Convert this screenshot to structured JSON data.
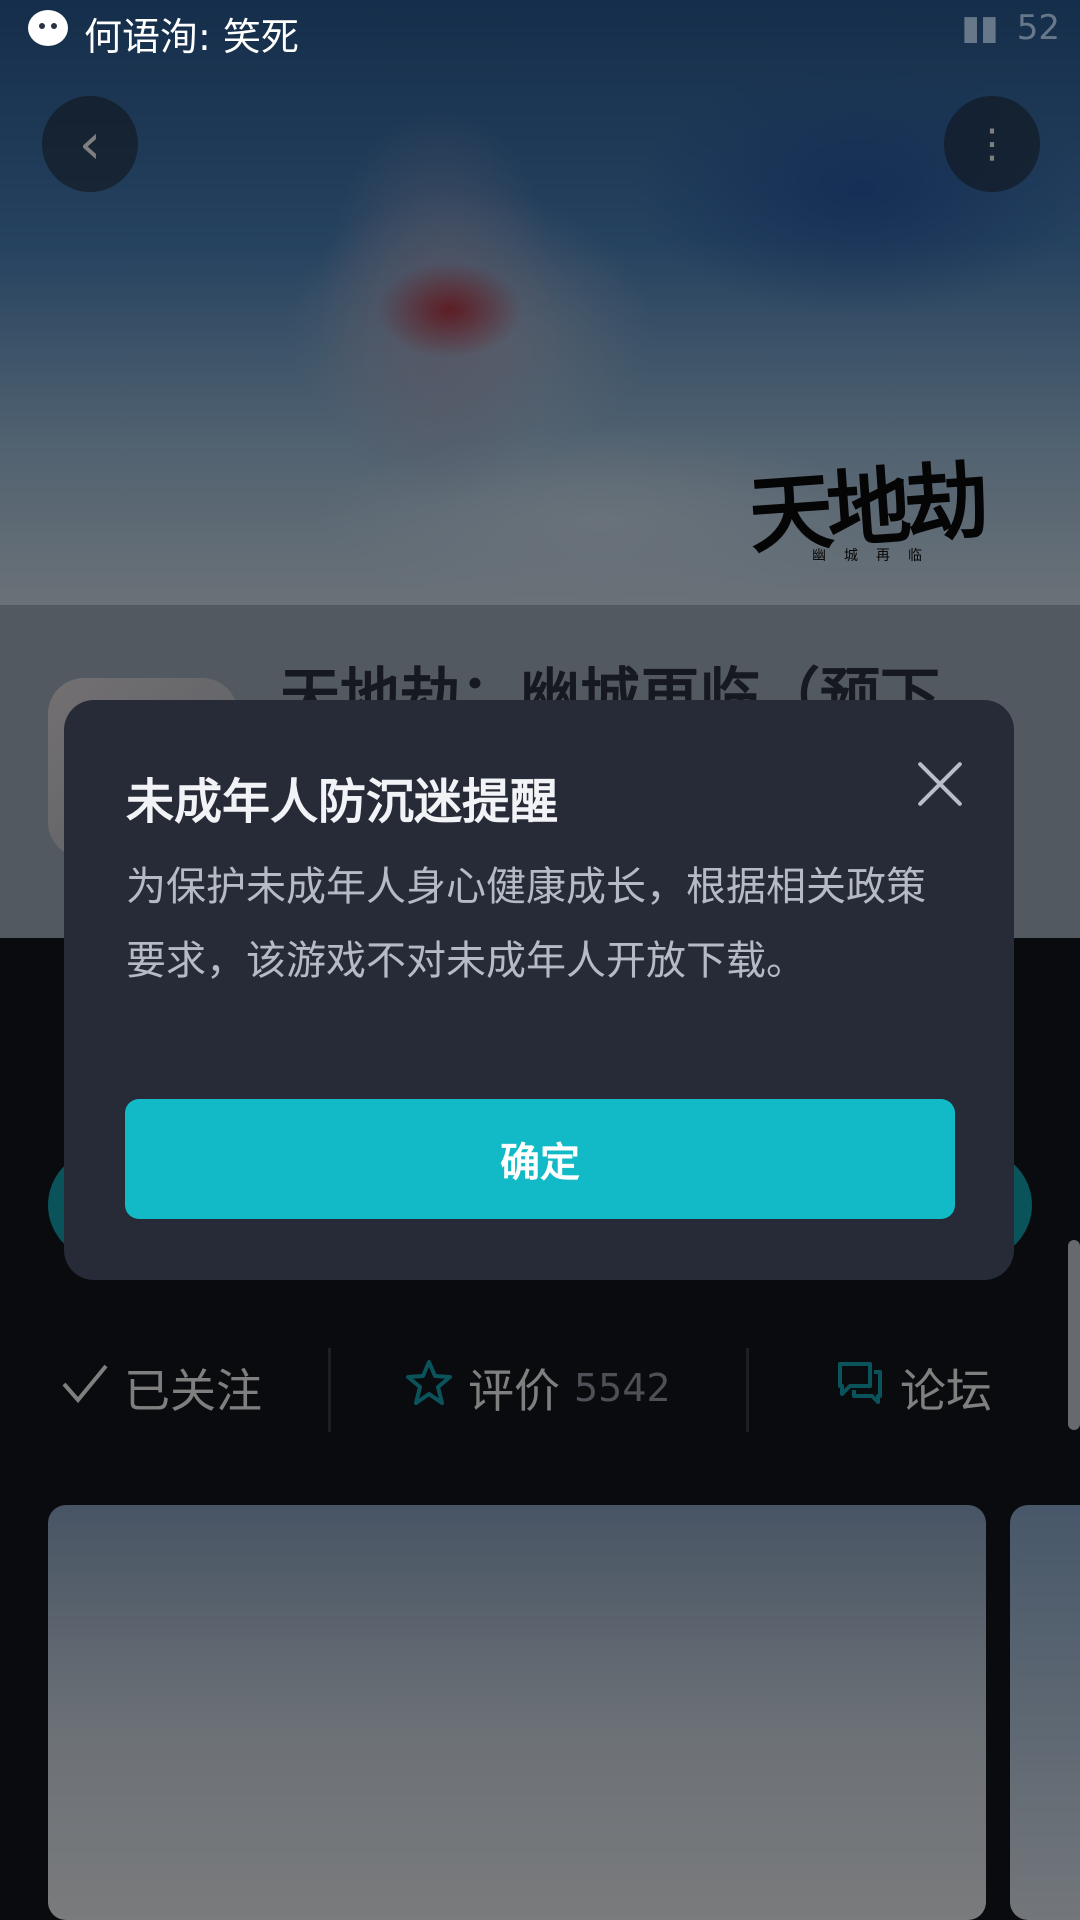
{
  "status_bar": {
    "notification_icon": "wechat-icon",
    "notification_text": "何语洵: 笑死",
    "battery_text": "52"
  },
  "hero": {
    "logo_text": "天地劫",
    "logo_subtitle": "幽城再临"
  },
  "game": {
    "title": "天地劫：幽城再临（预下"
  },
  "actions": {
    "follow_label": "已关注",
    "rate_label": "评价",
    "rate_count": "5542",
    "forum_label": "论坛"
  },
  "dialog": {
    "title": "未成年人防沉迷提醒",
    "body": "为保护未成年人身心健康成长，根据相关政策要求，该游戏不对未成年人开放下载。",
    "confirm_label": "确定"
  },
  "colors": {
    "accent": "#12b9c6",
    "dialog_bg": "#272a37"
  }
}
